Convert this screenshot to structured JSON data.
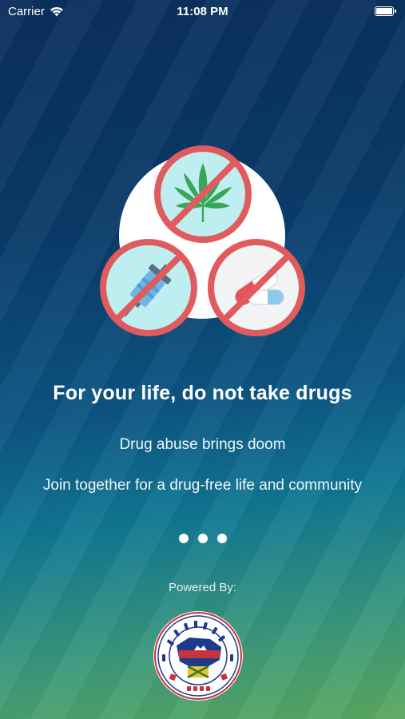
{
  "status_bar": {
    "carrier": "Carrier",
    "time": "11:08 PM"
  },
  "onboarding": {
    "title": "For your life, do not take drugs",
    "lines": [
      "Drug abuse brings doom",
      "Join together for a drug-free life and community"
    ],
    "page_count": 3,
    "current_page": 1,
    "icons": [
      "no-cannabis-icon",
      "no-syringe-icon",
      "no-pill-icon"
    ]
  },
  "footer": {
    "powered_by": "Powered By:",
    "logo_icon": "national-authority-emblem-icon"
  },
  "colors": {
    "background_top": "#0b2f5c",
    "background_bottom": "#5ba85e",
    "prohibition_red": "#e05b5e",
    "icon_fill": "#bfeef0"
  }
}
